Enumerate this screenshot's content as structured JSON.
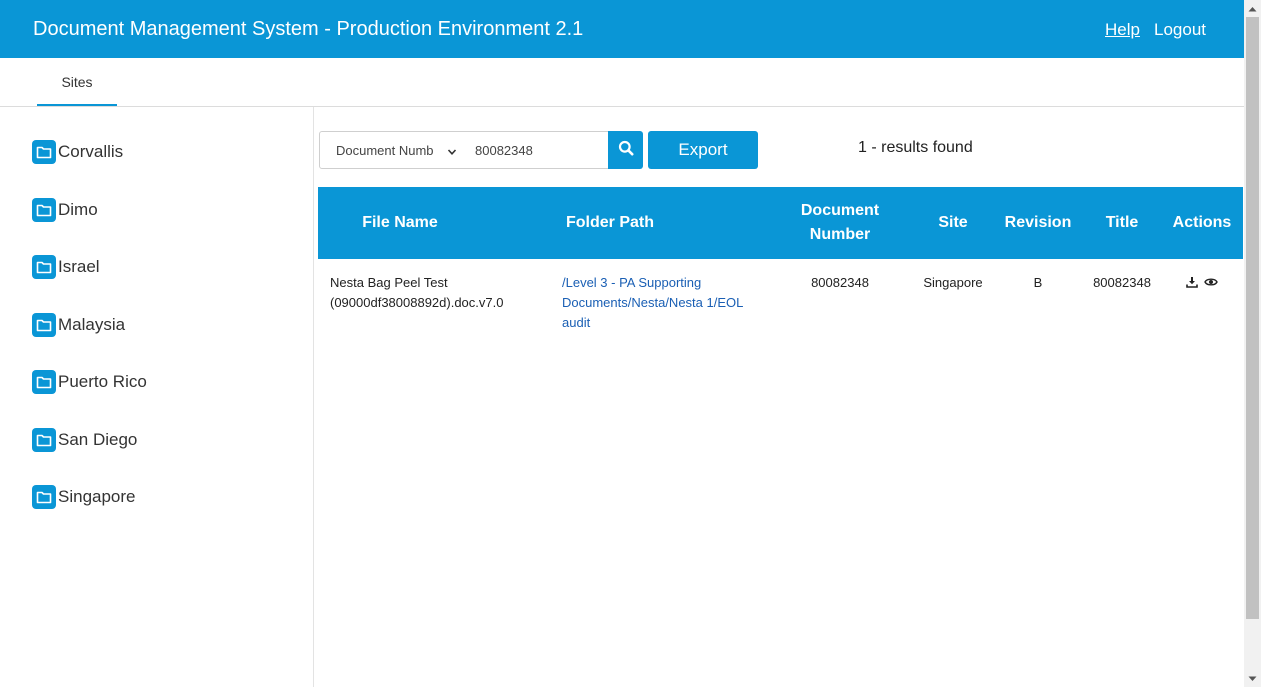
{
  "header": {
    "title": "Document Management System - Production Environment 2.1",
    "help_label": "Help",
    "logout_label": "Logout"
  },
  "tabs": [
    {
      "label": "Sites",
      "active": true
    }
  ],
  "sidebar": {
    "items": [
      {
        "label": "Corvallis",
        "icon": "folder-icon"
      },
      {
        "label": "Dimo",
        "icon": "folder-icon"
      },
      {
        "label": "Israel",
        "icon": "folder-icon"
      },
      {
        "label": "Malaysia",
        "icon": "folder-icon"
      },
      {
        "label": "Puerto Rico",
        "icon": "folder-icon"
      },
      {
        "label": "San Diego",
        "icon": "folder-icon"
      },
      {
        "label": "Singapore",
        "icon": "folder-icon"
      }
    ]
  },
  "search": {
    "field_selected": "Document Numb",
    "query_value": "80082348",
    "search_icon": "search-icon",
    "export_label": "Export",
    "results_text": "1 - results found"
  },
  "table": {
    "columns": [
      {
        "label": "File Name"
      },
      {
        "label": "Folder Path"
      },
      {
        "label": "Document Number"
      },
      {
        "label": "Site"
      },
      {
        "label": "Revision"
      },
      {
        "label": "Title"
      },
      {
        "label": "Actions"
      }
    ],
    "rows": [
      {
        "file_name": "Nesta Bag Peel Test (09000df38008892d).doc.v7.0",
        "folder_path": "/Level 3 - PA Supporting Documents/Nesta/Nesta 1/EOL audit",
        "document_number": "80082348",
        "site": "Singapore",
        "revision": "B",
        "title": "80082348",
        "actions": [
          "download-icon",
          "eye-icon"
        ]
      }
    ]
  },
  "colors": {
    "primary": "#0a96d6",
    "link": "#1a5fb4"
  }
}
